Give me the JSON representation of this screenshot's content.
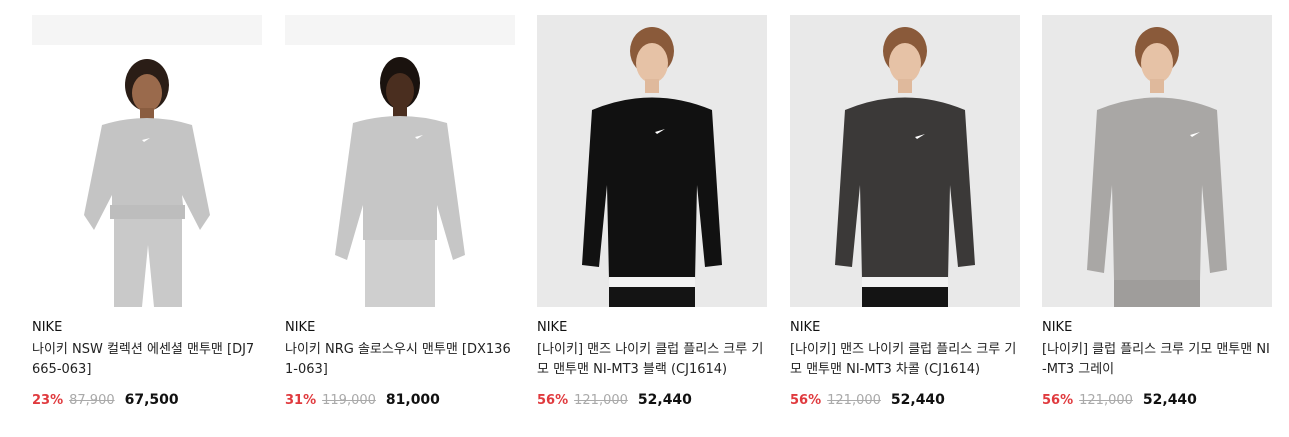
{
  "colors": {
    "discount": "#e03a3e",
    "original": "#aaaaaa",
    "text": "#111111"
  },
  "products": [
    {
      "brand": "NIKE",
      "name": "나이키 NSW 컬렉션 에센셜 맨투맨 [DJ7665-063]",
      "discount": "23%",
      "original_price": "87,900",
      "price": "67,500",
      "image": "model-grey-sweatshirt-woman"
    },
    {
      "brand": "NIKE",
      "name": "나이키 NRG 솔로스우시 맨투맨 [DX1361-063]",
      "discount": "31%",
      "original_price": "119,000",
      "price": "81,000",
      "image": "model-grey-sweatshirt-man"
    },
    {
      "brand": "NIKE",
      "name": "[나이키] 맨즈 나이키 클럽 플리스 크루 기모 맨투맨 NI-MT3 블랙 (CJ1614)",
      "discount": "56%",
      "original_price": "121,000",
      "price": "52,440",
      "image": "model-black-sweatshirt"
    },
    {
      "brand": "NIKE",
      "name": "[나이키] 맨즈 나이키 클럽 플리스 크루 기모 맨투맨 NI-MT3 차콜 (CJ1614)",
      "discount": "56%",
      "original_price": "121,000",
      "price": "52,440",
      "image": "model-charcoal-sweatshirt"
    },
    {
      "brand": "NIKE",
      "name": "[나이키] 클럽 플리스 크루 기모 맨투맨 NI-MT3 그레이",
      "discount": "56%",
      "original_price": "121,000",
      "price": "52,440",
      "image": "model-grey-sweatshirt"
    }
  ]
}
